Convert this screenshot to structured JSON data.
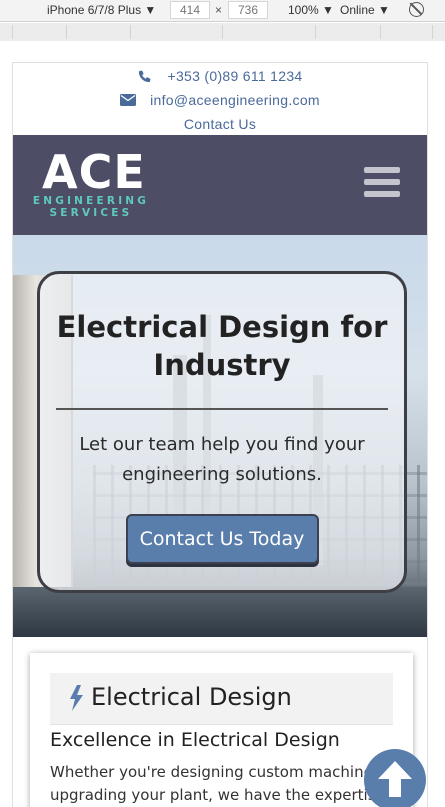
{
  "devtools": {
    "device": "iPhone 6/7/8 Plus ▼",
    "width": "414",
    "x_label": "×",
    "height": "736",
    "zoom": "100% ▼",
    "network": "Online ▼",
    "rotate_icon": "rotate-icon"
  },
  "contact": {
    "phone": "+353 (0)89 611 1234",
    "email": "info@aceengineering.com",
    "contact_link": "Contact Us",
    "phone_icon": "phone-icon",
    "email_icon": "envelope-icon"
  },
  "brand": {
    "name": "ACE",
    "tagline_1": "ENGINEERING",
    "tagline_2": "SERVICES",
    "nav_bg": "#4d4e66",
    "accent": "#5fc8c0"
  },
  "hero": {
    "title": "Electrical Design for Industry",
    "text": "Let our team help you find your engineering solutions.",
    "cta": "Contact Us Today",
    "button_color": "#5a7eab"
  },
  "service": {
    "icon": "bolt-icon",
    "title": "Electrical Design",
    "subtitle": "Excellence in Electrical Design",
    "line_1": "Whether you're designing custom machinery",
    "line_2": "upgrading your plant, we have the expertise to"
  },
  "scroll_top_icon": "arrow-up-icon"
}
